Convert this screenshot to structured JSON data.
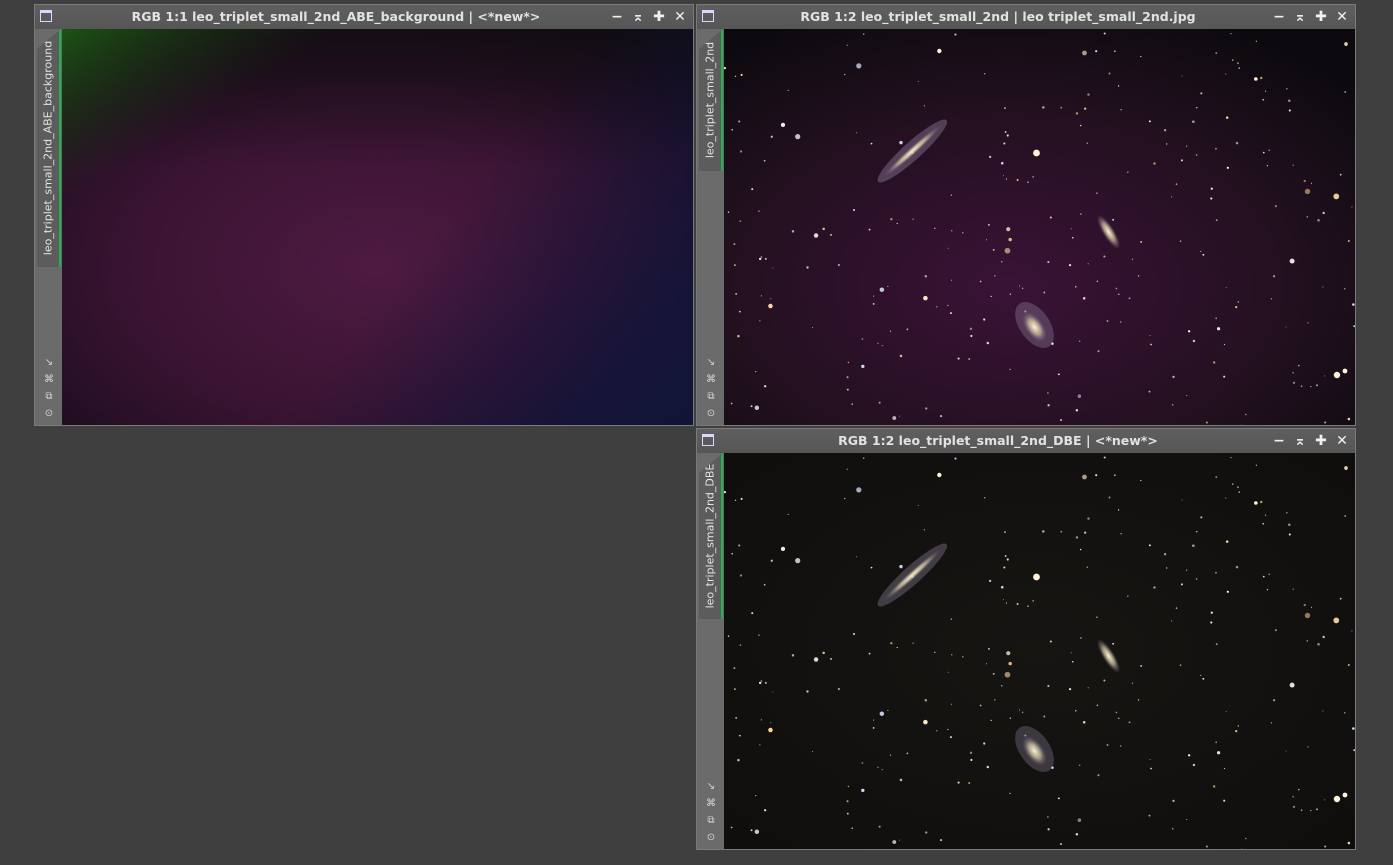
{
  "windows": [
    {
      "id": "abe",
      "title": "RGB 1:1 leo_triplet_small_2nd_ABE_background | <*new*>",
      "tab_label": "leo_triplet_small_2nd_ABE_background"
    },
    {
      "id": "orig",
      "title": "RGB 1:2 leo_triplet_small_2nd | leo triplet_small_2nd.jpg",
      "tab_label": "leo_triplet_small_2nd"
    },
    {
      "id": "dbe",
      "title": "RGB 1:2 leo_triplet_small_2nd_DBE | <*new*>",
      "tab_label": "leo_triplet_small_2nd_DBE"
    }
  ],
  "title_buttons": {
    "minimize": "−",
    "shade": "⌅",
    "maximize": "✚",
    "close": "✕"
  },
  "side_icons": [
    "↘",
    "⌘",
    "⧉",
    "⊙"
  ]
}
